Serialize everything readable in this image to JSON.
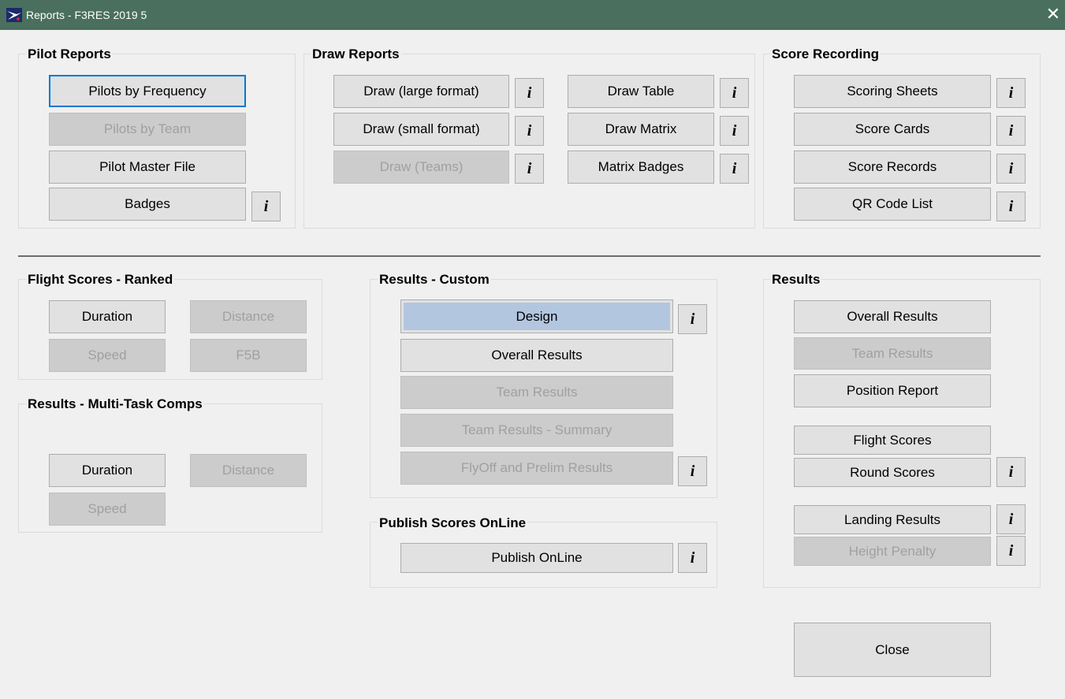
{
  "window": {
    "title": "Reports - F3RES 2019 5",
    "close_glyph": "✕",
    "app_icon": "f3res-app-icon"
  },
  "info_glyph": "i",
  "pilot_reports": {
    "title": "Pilot Reports",
    "pilots_by_frequency": "Pilots by Frequency",
    "pilots_by_team": "Pilots by Team",
    "pilot_master_file": "Pilot Master File",
    "badges": "Badges"
  },
  "draw_reports": {
    "title": "Draw Reports",
    "draw_large": "Draw (large format)",
    "draw_small": "Draw (small format)",
    "draw_teams": "Draw (Teams)",
    "draw_table": "Draw Table",
    "draw_matrix": "Draw Matrix",
    "matrix_badges": "Matrix Badges"
  },
  "score_recording": {
    "title": "Score Recording",
    "scoring_sheets": "Scoring Sheets",
    "score_cards": "Score Cards",
    "score_records": "Score Records",
    "qr_code_list": "QR Code List"
  },
  "flight_scores_ranked": {
    "title": "Flight Scores - Ranked",
    "duration": "Duration",
    "distance": "Distance",
    "speed": "Speed",
    "f5b": "F5B"
  },
  "results_multi_task": {
    "title": "Results - Multi-Task Comps",
    "duration": "Duration",
    "distance": "Distance",
    "speed": "Speed"
  },
  "results_custom": {
    "title": "Results - Custom",
    "design": "Design",
    "overall_results": "Overall Results",
    "team_results": "Team Results",
    "team_results_summary": "Team Results - Summary",
    "flyoff_prelim": "FlyOff and Prelim Results"
  },
  "publish": {
    "title": "Publish Scores OnLine",
    "publish_online": "Publish OnLine"
  },
  "results": {
    "title": "Results",
    "overall_results": "Overall Results",
    "team_results": "Team Results",
    "position_report": "Position Report",
    "flight_scores": "Flight Scores",
    "round_scores": "Round Scores",
    "landing_results": "Landing Results",
    "height_penalty": "Height Penalty"
  },
  "footer": {
    "close": "Close"
  }
}
